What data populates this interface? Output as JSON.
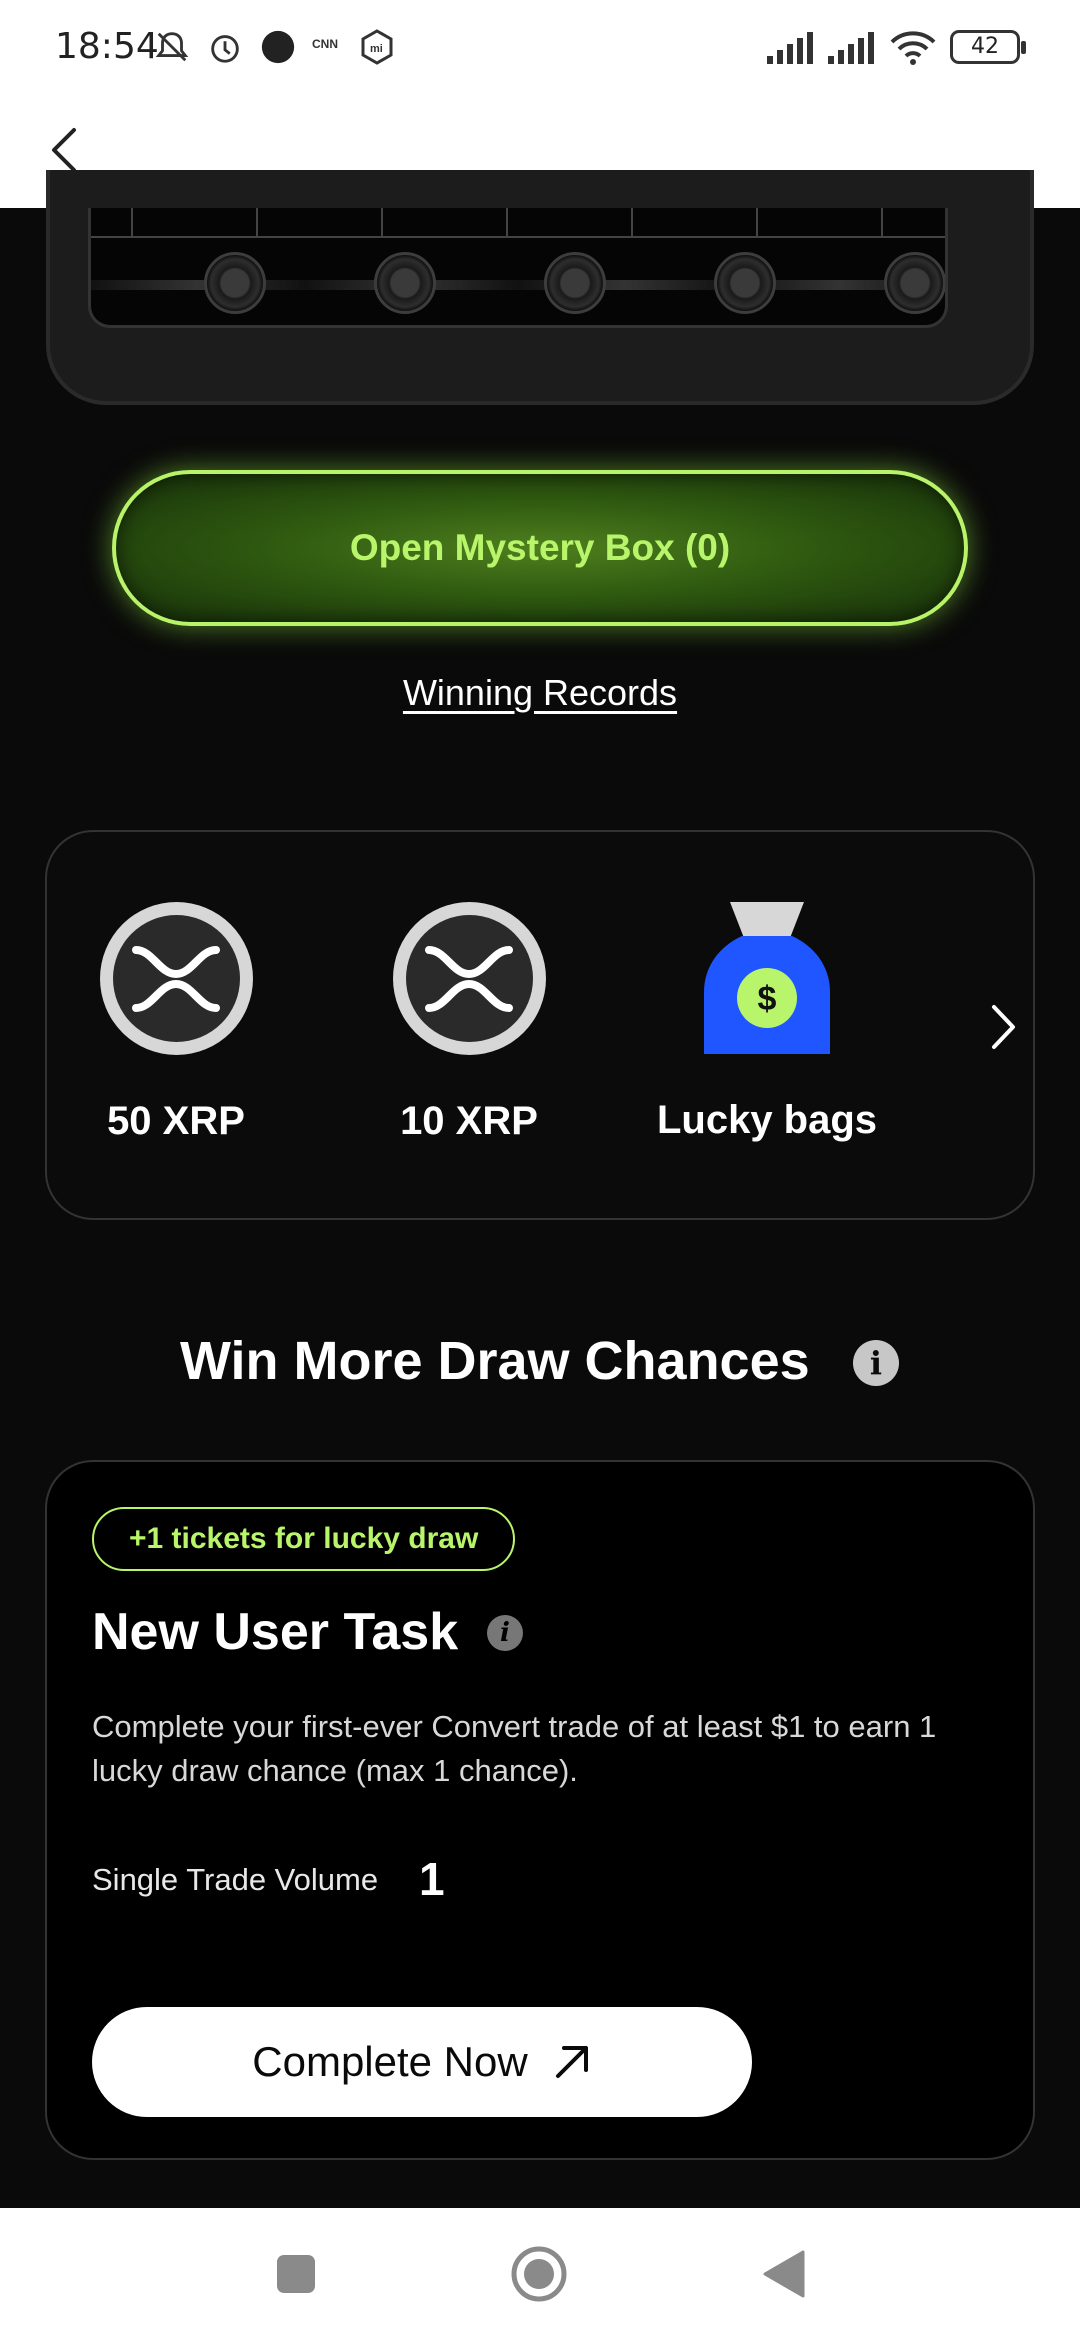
{
  "status_bar": {
    "time": "18:54",
    "battery": "42",
    "icons": [
      "bell-off-icon",
      "alarm-icon",
      "dot-icon",
      "cnn-icon",
      "mi-icon",
      "signal-icon",
      "signal-icon",
      "wifi-icon",
      "battery-icon"
    ]
  },
  "nav": {
    "back_icon": "chevron-left-icon"
  },
  "mystery": {
    "open_button": "Open Mystery Box (0)",
    "winning_records": "Winning Records"
  },
  "prizes": {
    "items": [
      {
        "label": "50 XRP",
        "icon": "xrp-icon"
      },
      {
        "label": "10 XRP",
        "icon": "xrp-icon"
      },
      {
        "label": "Lucky bags",
        "icon": "money-bag-icon"
      }
    ],
    "next_icon": "chevron-right-icon"
  },
  "win_more": {
    "title": "Win More Draw Chances",
    "info_icon": "i"
  },
  "task": {
    "badge": "+1 tickets for lucky draw",
    "title": "New User Task",
    "info_icon": "i",
    "description": "Complete your first-ever Convert trade of at least $1 to earn 1 lucky draw chance (max 1 chance).",
    "volume_label": "Single Trade Volume",
    "volume_value": "1",
    "button_label": "Complete Now"
  },
  "colors": {
    "accent_green": "#b8f56a",
    "background": "#0a0a0a",
    "bag_blue": "#1f56ff"
  },
  "bottom_nav": [
    "square-icon",
    "home-circle-icon",
    "back-triangle-icon"
  ]
}
